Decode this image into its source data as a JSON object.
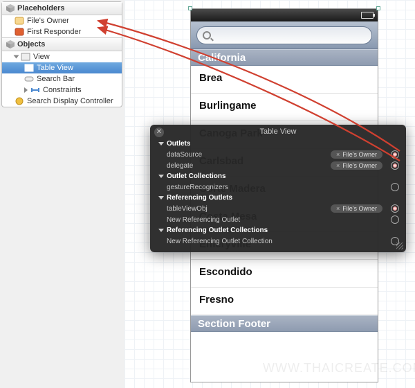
{
  "outline": {
    "section_placeholders": "Placeholders",
    "section_objects": "Objects",
    "files_owner": "File's Owner",
    "first_responder": "First Responder",
    "view": "View",
    "table_view": "Table View",
    "search_bar": "Search Bar",
    "constraints": "Constraints",
    "search_display_controller": "Search Display Controller"
  },
  "device": {
    "search_placeholder": "",
    "section_header": "California",
    "cells": [
      "Brea",
      "Burlingame",
      "Canoga Park",
      "Carlsbad",
      "Corte Madera",
      "Costa Mesa",
      "Emeryville",
      "Escondido",
      "Fresno"
    ],
    "section_footer": "Section Footer"
  },
  "hud": {
    "title": "Table View",
    "outlets_header": "Outlets",
    "datasource_label": "dataSource",
    "datasource_target": "File's Owner",
    "delegate_label": "delegate",
    "delegate_target": "File's Owner",
    "outlet_collections_header": "Outlet Collections",
    "gesture_recognizers": "gestureRecognizers",
    "referencing_outlets_header": "Referencing Outlets",
    "tableviewobj_label": "tableViewObj",
    "tableviewobj_target": "File's Owner",
    "new_referencing_outlet": "New Referencing Outlet",
    "referencing_outlet_collections_header": "Referencing Outlet Collections",
    "new_referencing_outlet_collection": "New Referencing Outlet Collection"
  },
  "watermark": "WWW.THAICREATE.COM"
}
